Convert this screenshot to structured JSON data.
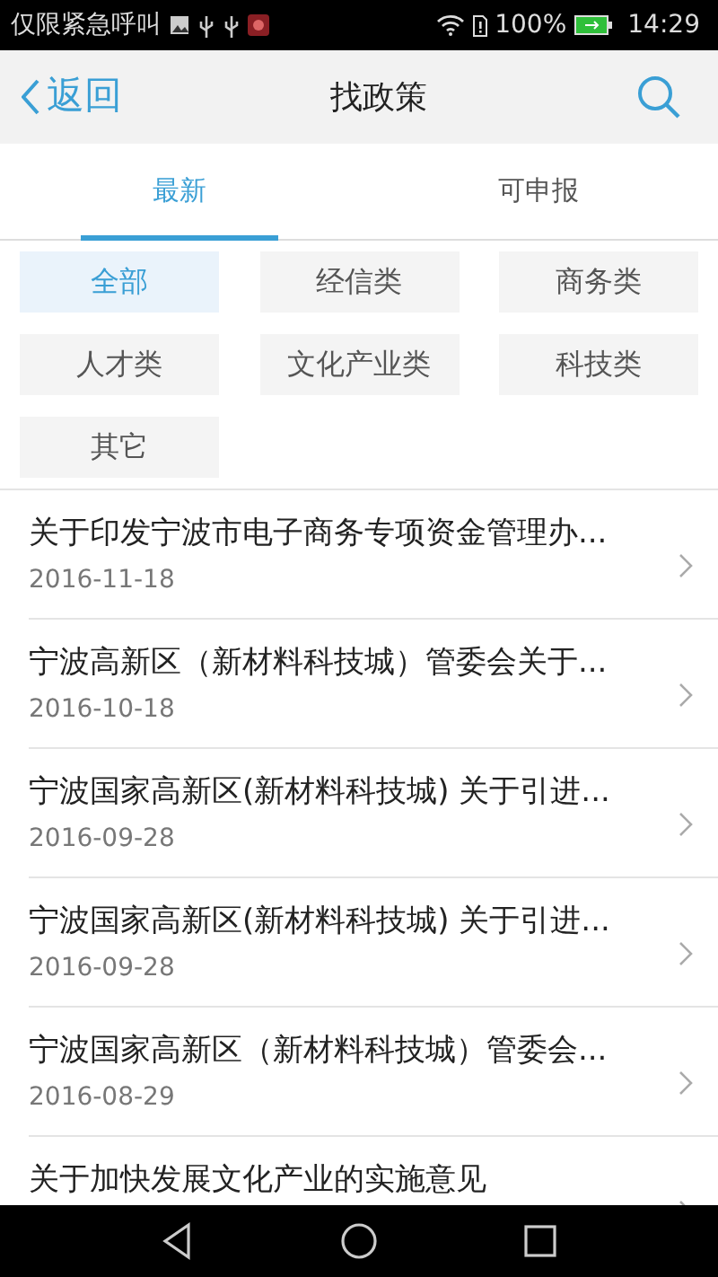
{
  "status_bar": {
    "carrier": "仅限紧急呼叫",
    "battery": "100%",
    "time": "14:29"
  },
  "header": {
    "back_label": "返回",
    "title": "找政策"
  },
  "tabs": [
    {
      "label": "最新",
      "selected": true
    },
    {
      "label": "可申报",
      "selected": false
    }
  ],
  "categories": [
    {
      "label": "全部",
      "selected": true
    },
    {
      "label": "经信类",
      "selected": false
    },
    {
      "label": "商务类",
      "selected": false
    },
    {
      "label": "人才类",
      "selected": false
    },
    {
      "label": "文化产业类",
      "selected": false
    },
    {
      "label": "科技类",
      "selected": false
    },
    {
      "label": "其它",
      "selected": false
    }
  ],
  "policies": [
    {
      "title": "关于印发宁波市电子商务专项资金管理办...",
      "date": "2016-11-18"
    },
    {
      "title": "宁波高新区（新材料科技城）管委会关于...",
      "date": "2016-10-18"
    },
    {
      "title": "宁波国家高新区(新材料科技城) 关于引进...",
      "date": "2016-09-28"
    },
    {
      "title": "宁波国家高新区(新材料科技城) 关于引进...",
      "date": "2016-09-28"
    },
    {
      "title": "宁波国家高新区（新材料科技城）管委会...",
      "date": "2016-08-29"
    },
    {
      "title": "关于加快发展文化产业的实施意见"
    }
  ]
}
